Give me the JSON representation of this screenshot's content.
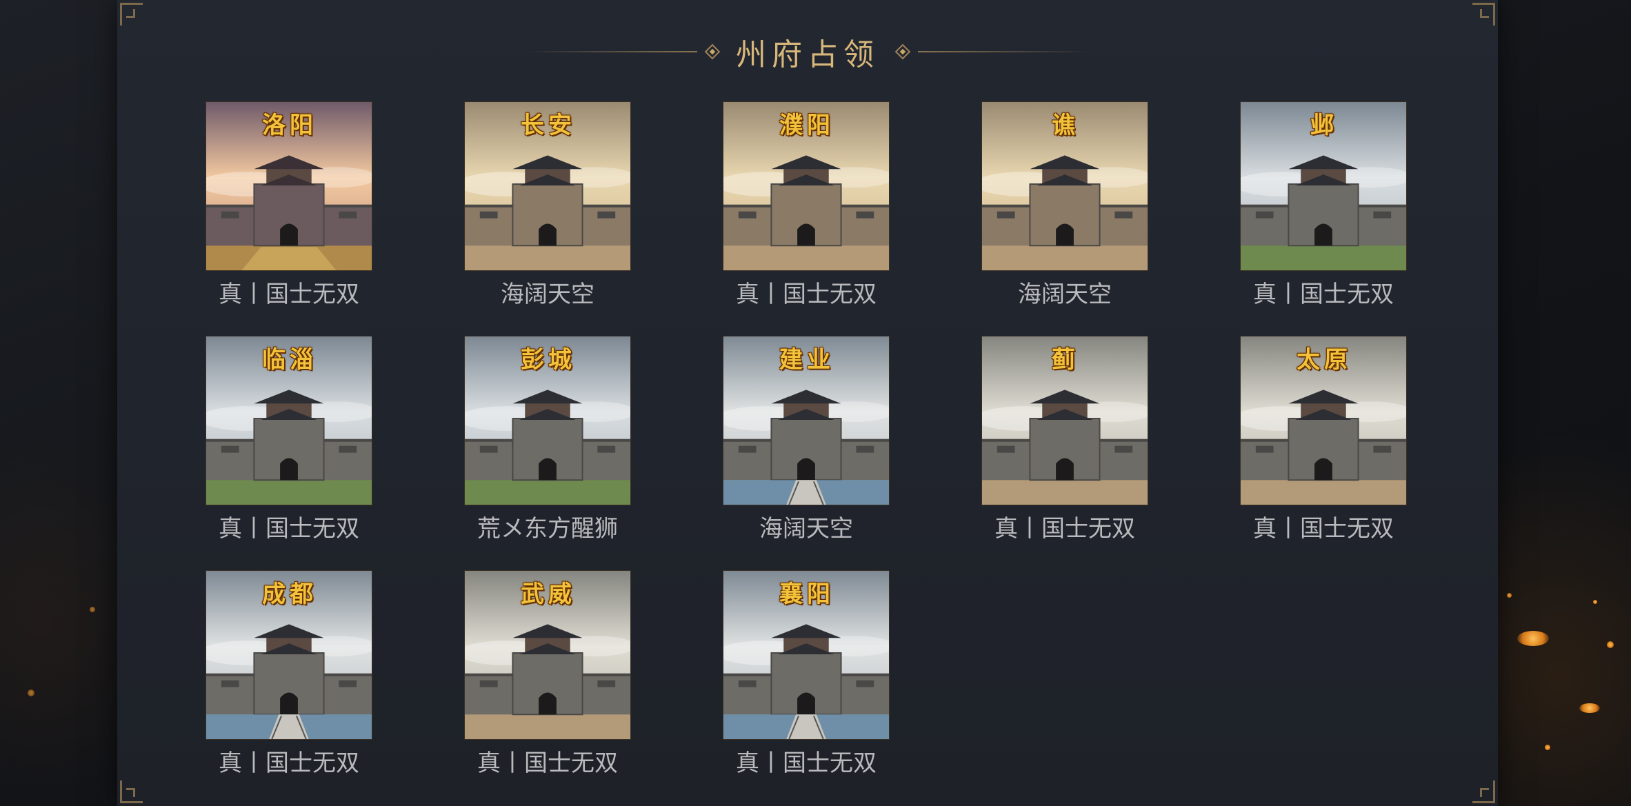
{
  "panel": {
    "title": "州府占领"
  },
  "cities": [
    {
      "name": "洛阳",
      "owner": "真丨国士无双",
      "style": "palace"
    },
    {
      "name": "长安",
      "owner": "海阔天空",
      "style": "warm"
    },
    {
      "name": "濮阳",
      "owner": "真丨国士无双",
      "style": "warm"
    },
    {
      "name": "谯",
      "owner": "海阔天空",
      "style": "warm"
    },
    {
      "name": "邺",
      "owner": "真丨国士无双",
      "style": "grass"
    },
    {
      "name": "临淄",
      "owner": "真丨国士无双",
      "style": "grass"
    },
    {
      "name": "彭城",
      "owner": "荒メ东方醒狮",
      "style": "grass"
    },
    {
      "name": "建业",
      "owner": "海阔天空",
      "style": "water"
    },
    {
      "name": "蓟",
      "owner": "真丨国士无双",
      "style": "sand"
    },
    {
      "name": "太原",
      "owner": "真丨国士无双",
      "style": "sand"
    },
    {
      "name": "成都",
      "owner": "真丨国士无双",
      "style": "water"
    },
    {
      "name": "武威",
      "owner": "真丨国士无双",
      "style": "sand"
    },
    {
      "name": "襄阳",
      "owner": "真丨国士无双",
      "style": "water"
    }
  ],
  "colors": {
    "city_name": "#f2c23a",
    "owner_text": "#b9babd",
    "title": "#d8b77a",
    "panel_bg": "#22262e"
  }
}
